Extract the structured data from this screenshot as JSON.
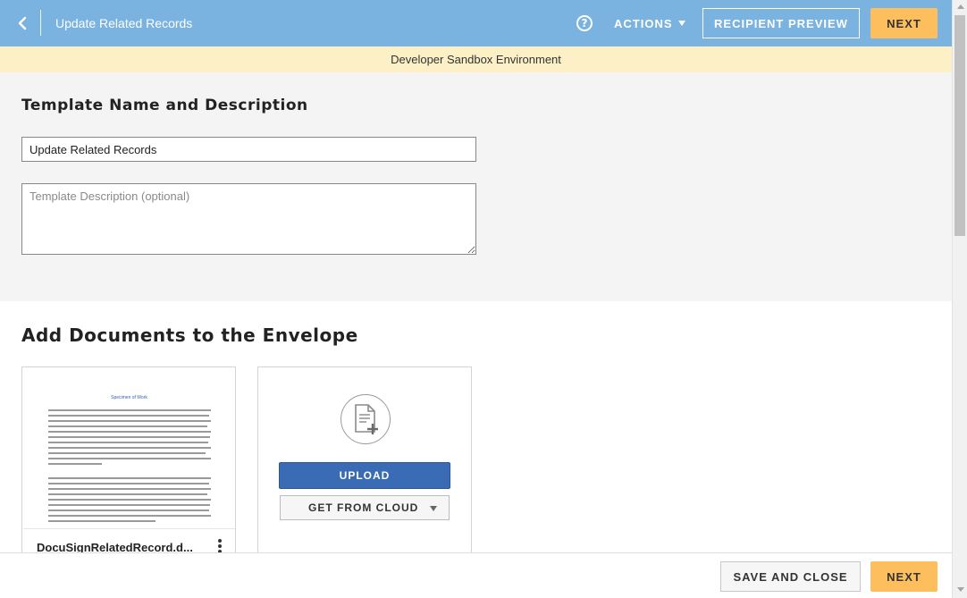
{
  "header": {
    "title": "Update Related Records",
    "help_glyph": "?",
    "actions_label": "ACTIONS",
    "recipient_preview_label": "RECIPIENT PREVIEW",
    "next_label": "NEXT"
  },
  "banner": {
    "text": "Developer Sandbox Environment"
  },
  "template": {
    "heading": "Template Name and Description",
    "name_value": "Update Related Records",
    "description_placeholder": "Template Description (optional)"
  },
  "documents": {
    "heading": "Add Documents to the Envelope",
    "items": [
      {
        "name": "DocuSignRelatedRecord.d...",
        "thumbnail_title": "Specimen of Work"
      }
    ],
    "upload_label": "UPLOAD",
    "cloud_label": "GET FROM CLOUD"
  },
  "footer": {
    "save_close_label": "SAVE AND CLOSE",
    "next_label": "NEXT"
  },
  "colors": {
    "header_bg": "#7ab3e0",
    "banner_bg": "#fdf0c7",
    "next_button": "#fdbf5e",
    "upload_button": "#3a6cb6",
    "section_bg": "#f4f4f4"
  }
}
